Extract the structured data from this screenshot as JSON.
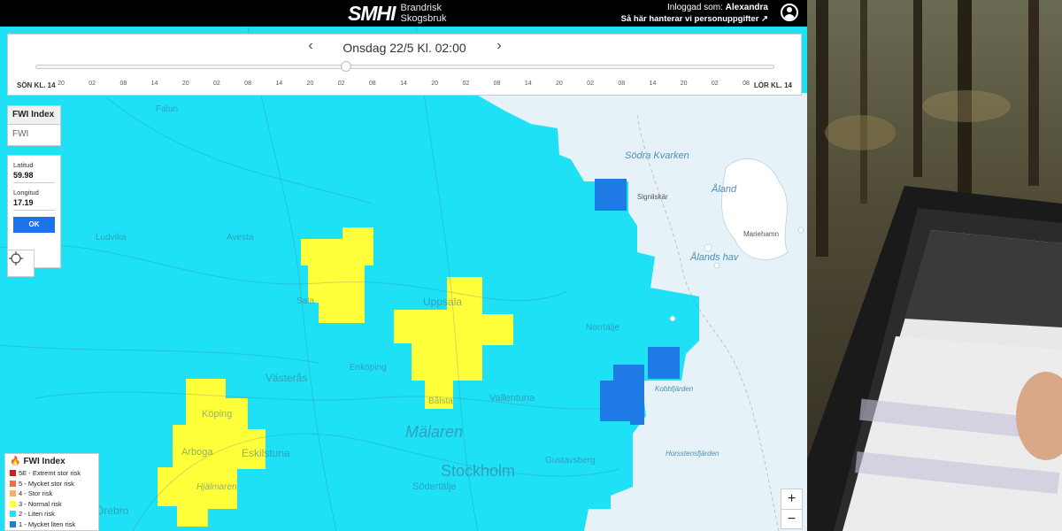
{
  "header": {
    "logo": "SMHI",
    "subtitle_line1": "Brandrisk",
    "subtitle_line2": "Skogsbruk",
    "user_prefix": "Inloggad som:",
    "user_name": "Alexandra",
    "privacy_link": "Så här hanterar vi personuppgifter"
  },
  "timeline": {
    "date_label": "Onsdag 22/5 Kl. 02:00",
    "start_label": "SÖN KL. 14",
    "end_label": "LÖR KL. 14",
    "ticks": [
      "20",
      "02",
      "08",
      "14",
      "20",
      "02",
      "08",
      "14",
      "20",
      "02",
      "08",
      "14",
      "20",
      "02",
      "08",
      "14",
      "20",
      "02",
      "08",
      "14",
      "20",
      "02",
      "08"
    ],
    "position": 0.42
  },
  "index_select": {
    "header": "FWI Index",
    "option": "FWI"
  },
  "coords": {
    "lat_label": "Latitud",
    "lat_value": "59.98",
    "lon_label": "Longitud",
    "lon_value": "17.19",
    "ok_label": "OK"
  },
  "legend": {
    "title": "FWI Index",
    "items": [
      {
        "label": "5E - Extremt stor risk",
        "color": "#d7191c"
      },
      {
        "label": "5 - Mycket stor risk",
        "color": "#f46d43"
      },
      {
        "label": "4 - Stor risk",
        "color": "#fdae61"
      },
      {
        "label": "3 - Normal risk",
        "color": "#ffff3a"
      },
      {
        "label": "2 - Liten risk",
        "color": "#1ee1f5"
      },
      {
        "label": "1 - Mycket liten risk",
        "color": "#1e7be6"
      }
    ]
  },
  "zoom": {
    "in": "+",
    "out": "−"
  },
  "places": {
    "sodra_kvarken": "Södra Kvarken",
    "aland": "Åland",
    "alands_hav": "Ålands hav",
    "signilskar": "Signilskär",
    "mariehamn": "Mariehamn",
    "kobbfjarden": "Kobbfjärden",
    "horsstensfjarden": "Horsstensfjärden",
    "stockholm": "Stockholm",
    "malaren": "Mälaren",
    "uppsala": "Uppsala",
    "vasteras": "Västerås",
    "eskilstuna": "Eskilstuna",
    "orebro": "Örebro",
    "arboga": "Arboga",
    "koping": "Köping",
    "sodertalje": "Södertälje",
    "enkoping": "Enköping",
    "norrtalje": "Norrtälje",
    "ludvika": "Ludvika",
    "avesta": "Avesta",
    "sala": "Sala",
    "falun": "Falun",
    "hjalmaren": "Hjälmaren",
    "balsta": "Bålsta",
    "vallentuna": "Vallentuna",
    "gustavsberg": "Gustavsberg"
  },
  "colors": {
    "risk_low": "#1ee1f5",
    "risk_very_low": "#1e7be6",
    "risk_normal": "#ffff3a",
    "sea": "#e6f2f7",
    "header_bg": "#000000"
  }
}
